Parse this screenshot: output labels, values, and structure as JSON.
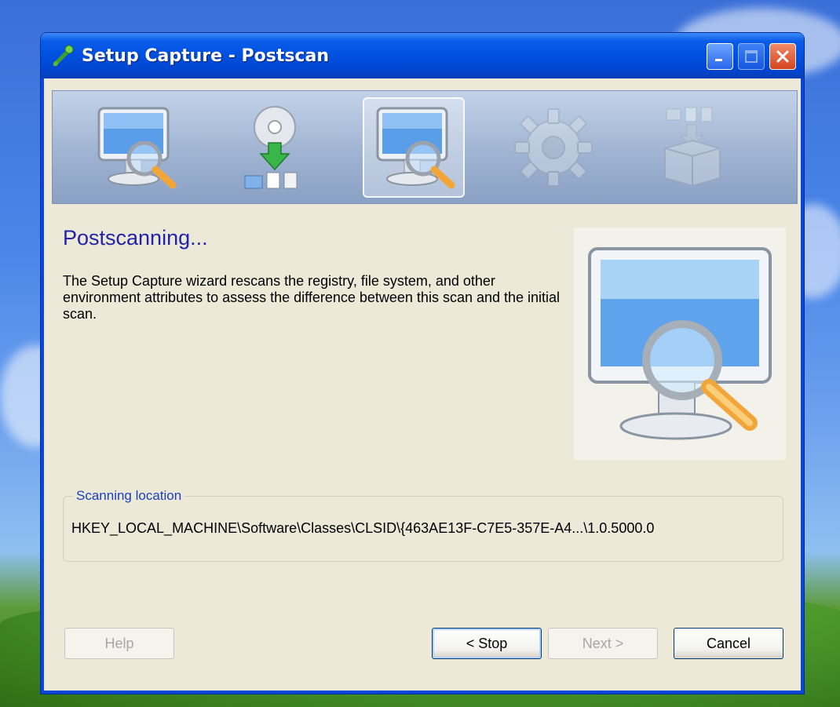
{
  "window": {
    "title": "Setup Capture - Postscan",
    "title_buttons": [
      "minimize-icon",
      "maximize-icon",
      "close-icon"
    ]
  },
  "banner": {
    "steps": [
      {
        "icon": "monitor-magnifier-icon",
        "state": "done"
      },
      {
        "icon": "disc-install-icon",
        "state": "done"
      },
      {
        "icon": "monitor-magnifier-icon",
        "state": "active"
      },
      {
        "icon": "gear-icon",
        "state": "pending"
      },
      {
        "icon": "package-box-icon",
        "state": "pending"
      }
    ]
  },
  "page": {
    "heading": "Postscanning...",
    "description": "The Setup Capture wizard rescans the registry, file system, and other environment attributes to assess the difference between this scan and the initial scan.",
    "illustration": "monitor-magnifier-icon"
  },
  "scan": {
    "legend": "Scanning location",
    "location": "HKEY_LOCAL_MACHINE\\Software\\Classes\\CLSID\\{463AE13F-C7E5-357E-A4...\\1.0.5000.0"
  },
  "buttons": {
    "help": "Help",
    "stop": "< Stop",
    "next": "Next >",
    "cancel": "Cancel"
  },
  "colors": {
    "title_bar": "#0050e0",
    "heading": "#2222aa",
    "legend": "#1a3fc0",
    "client_bg": "#ece9d8"
  }
}
